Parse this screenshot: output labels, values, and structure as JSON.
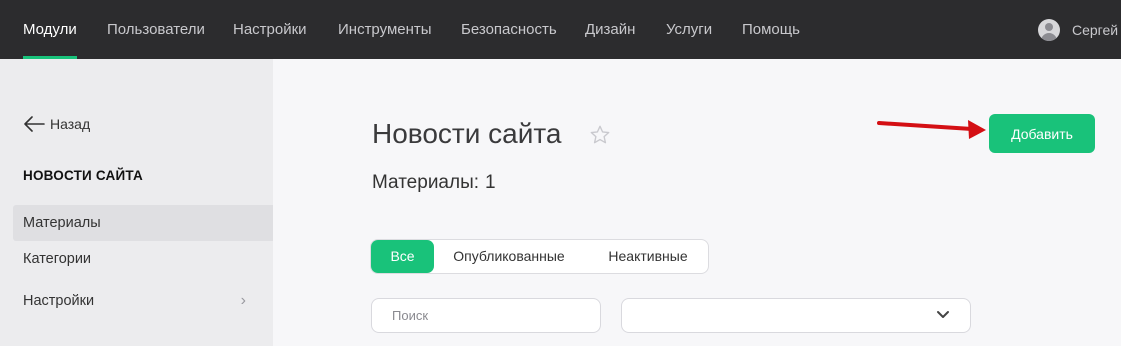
{
  "topnav": {
    "items": [
      {
        "label": "Модули",
        "active": true
      },
      {
        "label": "Пользователи"
      },
      {
        "label": "Настройки"
      },
      {
        "label": "Инструменты"
      },
      {
        "label": "Безопасность"
      },
      {
        "label": "Дизайн"
      },
      {
        "label": "Услуги"
      },
      {
        "label": "Помощь"
      }
    ],
    "user_name": "Сергей",
    "user_icon": "user-avatar-icon"
  },
  "sidebar": {
    "back_label": "Назад",
    "back_icon": "arrow-left-icon",
    "section_title": "НОВОСТИ САЙТА",
    "items": [
      {
        "label": "Материалы",
        "active": true
      },
      {
        "label": "Категории"
      },
      {
        "label": "Настройки",
        "icon": "chevron-right-icon"
      }
    ]
  },
  "main": {
    "title": "Новости сайта",
    "star_icon": "star-icon",
    "count_label": "Материалы:",
    "count_value": "1",
    "add_label": "Добавить",
    "tabs": [
      {
        "label": "Все",
        "active": true
      },
      {
        "label": "Опубликованные"
      },
      {
        "label": "Неактивные"
      }
    ],
    "search_placeholder": "Поиск",
    "filter_value": "",
    "filter_icon": "chevron-down-icon"
  },
  "colors": {
    "accent": "#19c27a",
    "topbar": "#2c2c2e",
    "sidebar": "#ececee",
    "annotation_arrow": "#d40f14"
  }
}
